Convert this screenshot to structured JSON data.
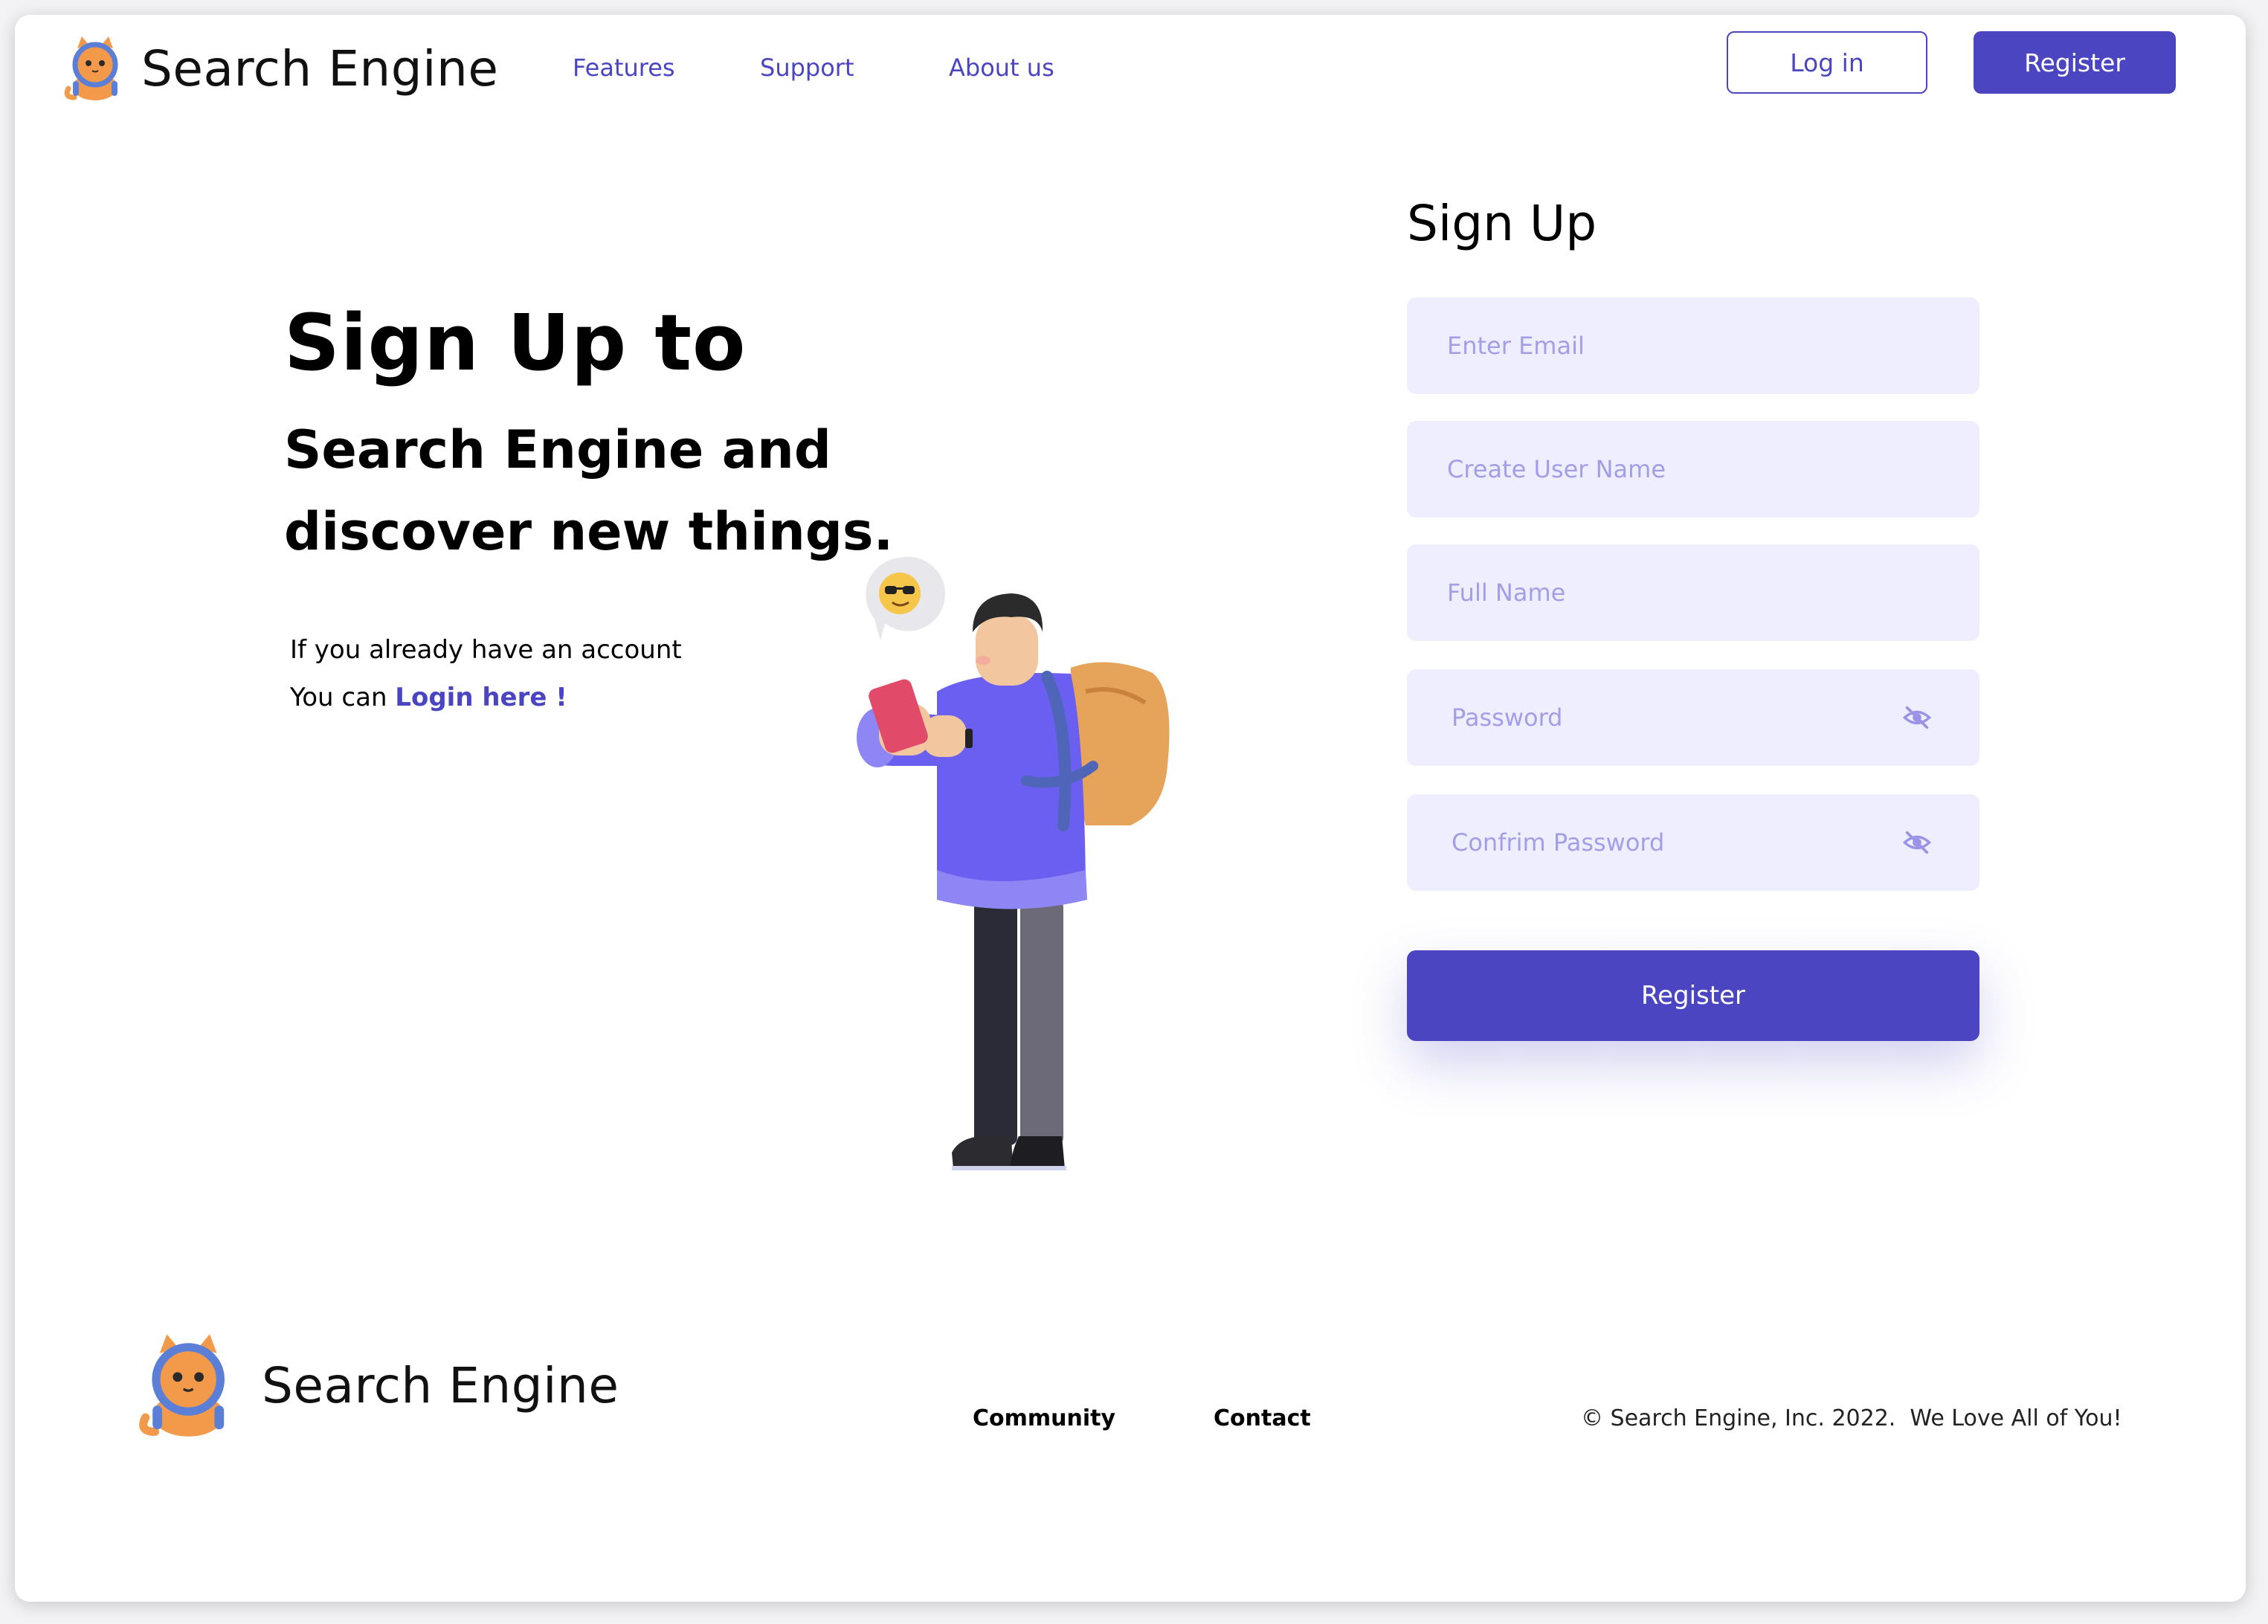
{
  "brand": {
    "name": "Search Engine"
  },
  "nav": {
    "features": "Features",
    "support": "Support",
    "about": "About us"
  },
  "header": {
    "login_label": "Log in",
    "register_label": "Register"
  },
  "hero": {
    "title": "Sign Up to",
    "subtitle_line1": "Search Engine and",
    "subtitle_line2": "discover new things.",
    "note_line1": "If you already have an account",
    "note_line2_prefix": "You can ",
    "login_link": "Login here !"
  },
  "form": {
    "title": "Sign Up",
    "email_placeholder": "Enter Email",
    "username_placeholder": "Create User Name",
    "fullname_placeholder": "Full Name",
    "password_placeholder": "Password",
    "confirm_placeholder": "Confrim Password",
    "submit_label": "Register"
  },
  "footer": {
    "community": "Community",
    "contact": "Contact",
    "copyright": "© Search Engine, Inc. 2022.  We Love All of You!"
  },
  "icons": {
    "mascot": "cat-mascot-icon",
    "eye_off": "eye-off-icon",
    "emoji": "sunglasses-emoji-icon"
  },
  "colors": {
    "accent": "#4b45c2",
    "field_bg": "#efeefe",
    "placeholder": "#a49ee8"
  }
}
